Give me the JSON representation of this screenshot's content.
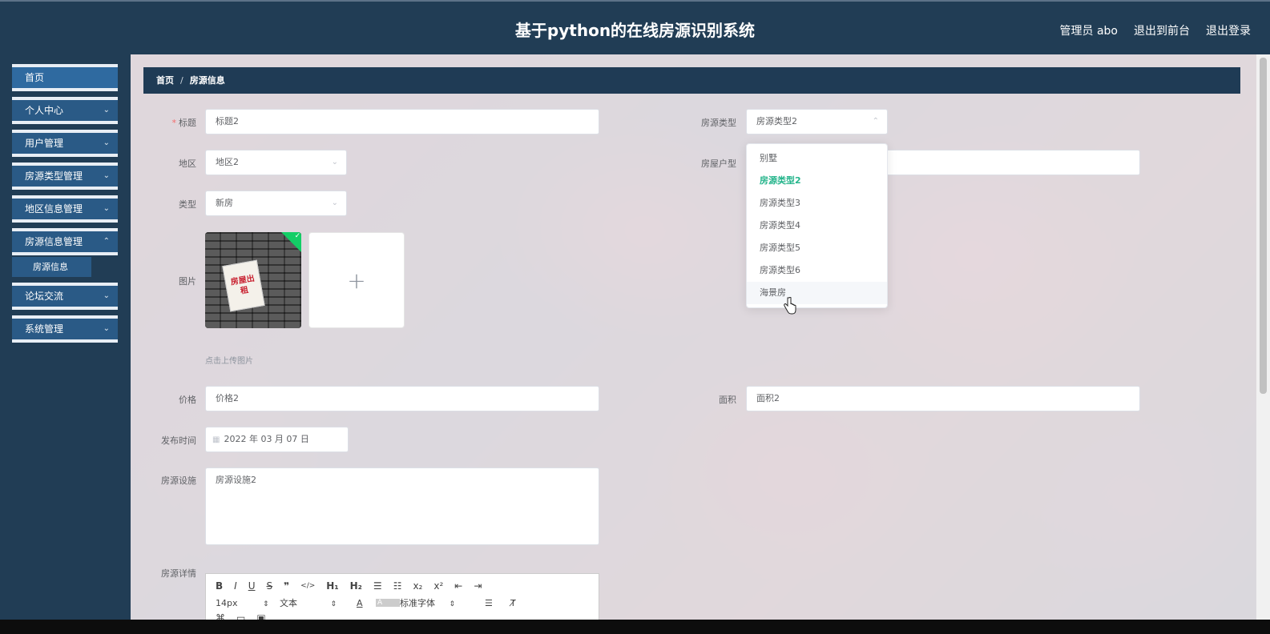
{
  "header": {
    "title": "基于python的在线房源识别系统",
    "user_label": "管理员 abo",
    "front_label": "退出到前台",
    "logout_label": "退出登录"
  },
  "sidebar": {
    "items": [
      {
        "label": "首页"
      },
      {
        "label": "个人中心"
      },
      {
        "label": "用户管理"
      },
      {
        "label": "房源类型管理"
      },
      {
        "label": "地区信息管理"
      },
      {
        "label": "房源信息管理"
      },
      {
        "label": "论坛交流"
      },
      {
        "label": "系统管理"
      }
    ],
    "sub_item": "房源信息"
  },
  "breadcrumb": {
    "home": "首页",
    "sep": "/",
    "current": "房源信息"
  },
  "form": {
    "title_label": "标题",
    "title_required": "*",
    "title_value": "标题2",
    "type_label": "房源类型",
    "type_value": "房源类型2",
    "region_label": "地区",
    "region_value": "地区2",
    "layout_label": "房屋户型",
    "kind_label": "类型",
    "kind_value": "新房",
    "image_label": "图片",
    "image_sign": "房屋出租",
    "upload_tip": "点击上传图片",
    "upload_plus": "+",
    "price_label": "价格",
    "price_value": "价格2",
    "area_label": "面积",
    "area_value": "面积2",
    "date_label": "发布时间",
    "date_value": "2022 年 03 月 07 日",
    "facility_label": "房源设施",
    "facility_value": "房源设施2",
    "detail_label": "房源详情"
  },
  "editor": {
    "row1": [
      "B",
      "I",
      "U",
      "S",
      "❞",
      "</>",
      "H₁",
      "H₂",
      "☰",
      "☷",
      "x₂",
      "x²",
      "⇤",
      "⇥"
    ],
    "font_size": "14px",
    "text_style": "文本",
    "font_family": "标准字体",
    "clear_format": "T̸"
  },
  "dropdown": {
    "options": [
      "别墅",
      "房源类型2",
      "房源类型3",
      "房源类型4",
      "房源类型5",
      "房源类型6",
      "海景房"
    ],
    "selected_index": 1,
    "hover_index": 6
  }
}
